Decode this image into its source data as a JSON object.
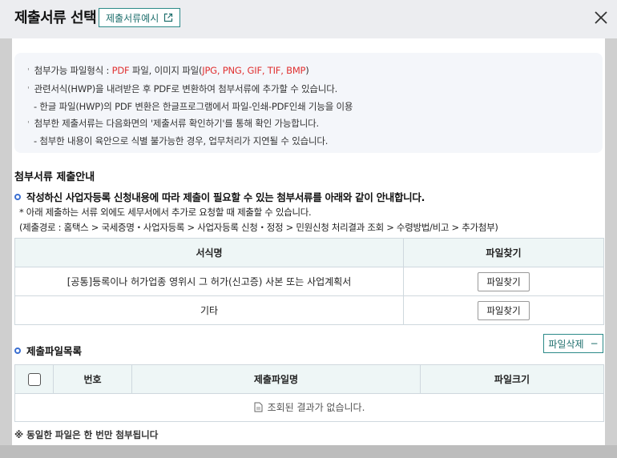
{
  "header": {
    "title": "제출서류 선택",
    "example_button": "제출서류예시"
  },
  "info": {
    "line1_prefix": "첨부가능 파일형식 : ",
    "line1_pdf": "PDF",
    "line1_mid": " 파일, 이미지 파일(",
    "line1_formats": "JPG, PNG, GIF, TIF, BMP",
    "line1_suffix": ")",
    "line2": "관련서식(HWP)을 내려받은 후 PDF로 변환하여 첨부서류에 추가할 수 있습니다.",
    "line3": "- 한글 파일(HWP)의 PDF 변환은 한글프로그램에서 파일-인쇄-PDF인쇄 기능을 이용",
    "line4": "첨부한 제출서류는 다음화면의 '제출서류 확인하기'를 통해 확인 가능합니다.",
    "line5": "- 첨부한 내용이 육안으로 식별 불가능한 경우, 업무처리가 지연될 수 있습니다."
  },
  "guide": {
    "title": "첨부서류 제출안내",
    "bullet": "작성하신 사업자등록 신청내용에 따라 제출이 필요할 수 있는 첨부서류를 아래와 같이 안내합니다.",
    "note1": "* 아래 제출하는 서류 외에도 세무서에서 추가로 요청할 때 제출할 수 있습니다.",
    "note2": "(제출경로 : 홈택스 > 국세증명・사업자등록 > 사업자등록 신청・정정 > 민원신청 처리결과 조회 > 수령방법/비고 > 추가첨부)"
  },
  "doc_table": {
    "headers": [
      "서식명",
      "파일찾기"
    ],
    "rows": [
      {
        "name": "[공통]등록이나 허가업종 영위시 그 허가(신고증) 사본 또는 사업계획서",
        "button": "파일찾기"
      },
      {
        "name": "기타",
        "button": "파일찾기"
      }
    ]
  },
  "file_list": {
    "title": "제출파일목록",
    "delete_button": "파일삭제",
    "delete_symbol": "−",
    "headers": [
      "번호",
      "제출파일명",
      "파일크기"
    ],
    "empty_message": "조회된 결과가 없습니다."
  },
  "footer_note": "※ 동일한 파일은 한 번만 첨부됩니다",
  "colors": {
    "accent": "#2b8a88",
    "highlight_red": "#e03131",
    "bullet_blue": "#3b6fd1"
  }
}
